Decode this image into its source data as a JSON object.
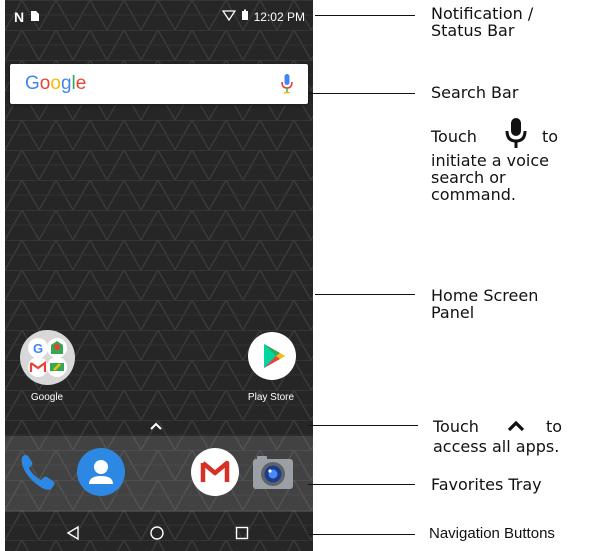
{
  "status_bar": {
    "time": "12:02 PM",
    "left_icons": [
      "n-icon",
      "sim-card-icon"
    ],
    "right_icons": [
      "wifi-icon",
      "battery-icon"
    ]
  },
  "search_bar": {
    "brand": "Google",
    "colors": {
      "blue": "#4285F4",
      "red": "#EA4335",
      "yellow": "#FBBC05",
      "green": "#34A853"
    }
  },
  "home": {
    "apps": [
      {
        "label": "Google",
        "icon": "google-folder-icon"
      },
      {
        "label": "Play Store",
        "icon": "play-store-icon"
      }
    ]
  },
  "favorites": [
    "phone-icon",
    "contacts-icon",
    "gmail-icon",
    "camera-icon"
  ],
  "navigation": [
    "back-icon",
    "home-icon",
    "recents-icon"
  ],
  "annotations": {
    "status_bar": [
      "Notification /",
      "Status Bar"
    ],
    "search_bar": "Search Bar",
    "voice_touch": "Touch",
    "voice_to": "to",
    "voice_rest": [
      "initiate a voice",
      "search or",
      "command."
    ],
    "home_panel": [
      "Home Screen",
      "Panel"
    ],
    "apps_touch": "Touch",
    "apps_to": "to",
    "apps_rest": "access all apps.",
    "favorites": "Favorites Tray",
    "nav_buttons": "Navigation Buttons"
  }
}
